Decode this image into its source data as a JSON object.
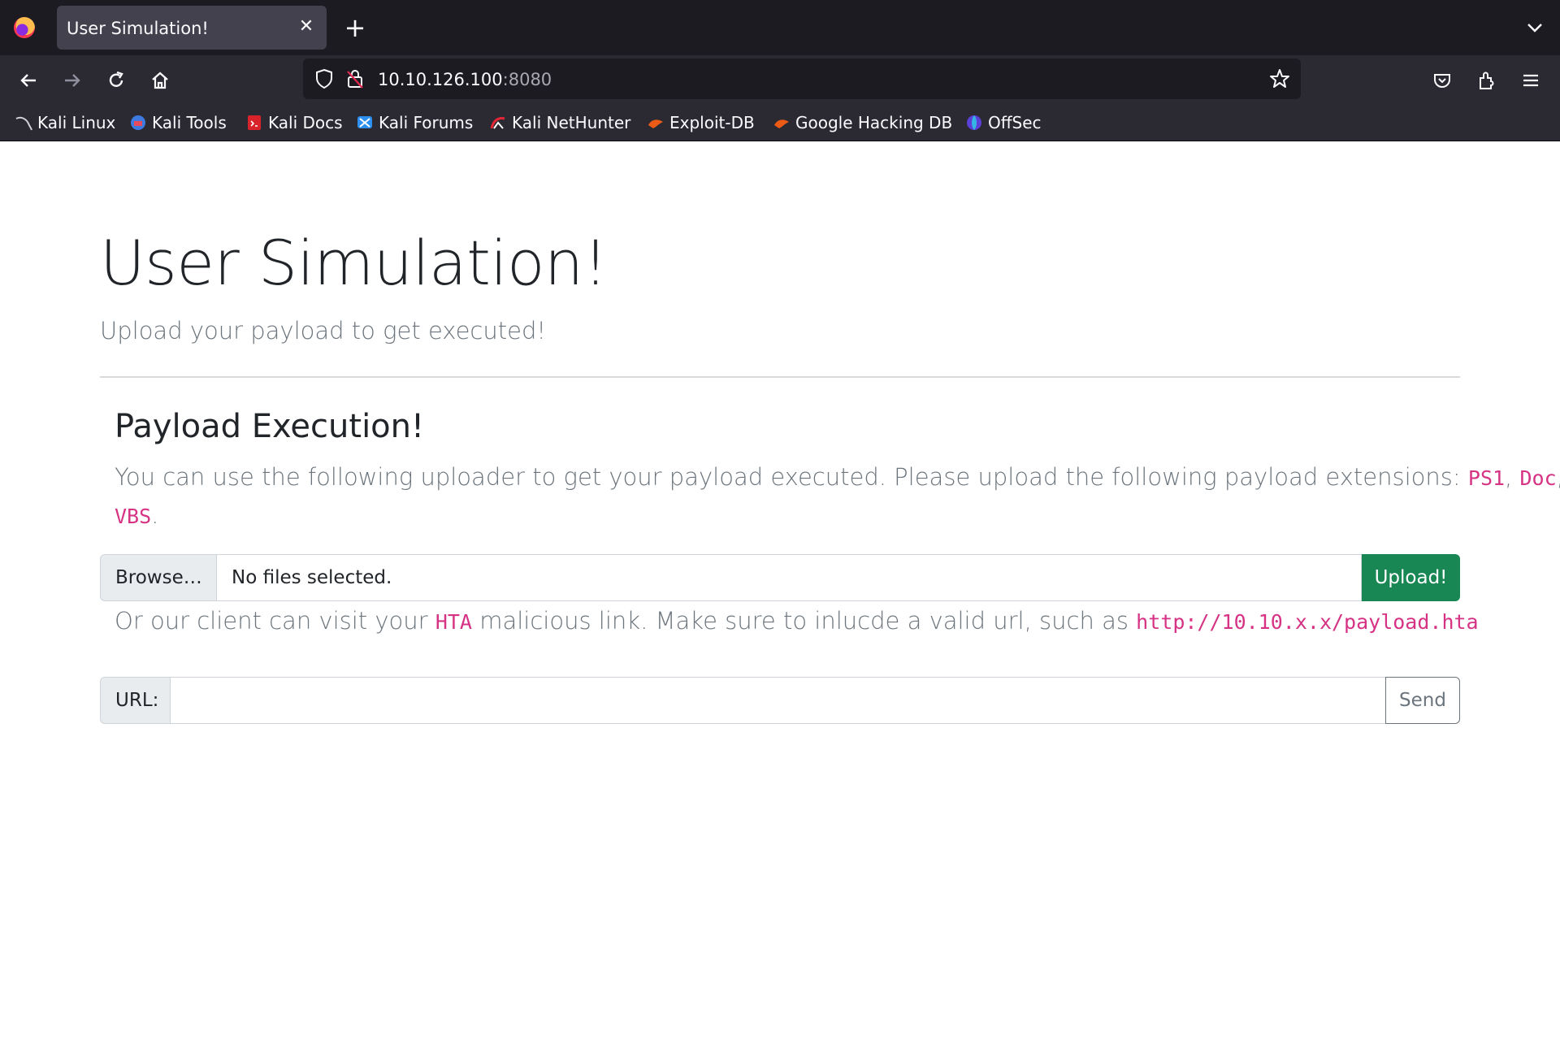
{
  "browser": {
    "tab_title": "User Simulation!",
    "tab_close_icon": "close-icon",
    "new_tab_icon": "plus-icon",
    "url_host": "10.10.126.100",
    "url_port": ":8080",
    "bookmarks": [
      {
        "label": "Kali Linux",
        "icon": "kali-dragon-icon"
      },
      {
        "label": "Kali Tools",
        "icon": "kali-tools-icon"
      },
      {
        "label": "Kali Docs",
        "icon": "kali-docs-icon"
      },
      {
        "label": "Kali Forums",
        "icon": "kali-forums-icon"
      },
      {
        "label": "Kali NetHunter",
        "icon": "nethunter-icon"
      },
      {
        "label": "Exploit-DB",
        "icon": "exploit-db-icon"
      },
      {
        "label": "Google Hacking DB",
        "icon": "ghdb-icon"
      },
      {
        "label": "OffSec",
        "icon": "offsec-icon"
      }
    ]
  },
  "page": {
    "title": "User Simulation!",
    "lead": "Upload your payload to get executed!",
    "section_title": "Payload Execution!",
    "upload_text_1": "You can use the following uploader to get your payload executed. Please upload the following payload extensions: ",
    "ext_ps1": "PS1",
    "sep_1": ", ",
    "ext_doc": "Doc",
    "sep_2": ",",
    "ext_vbs": "VBS",
    "period": ".",
    "browse_label": "Browse…",
    "file_status": "No files selected.",
    "upload_button": "Upload!",
    "link_text_1": "Or our client can visit your ",
    "hta_code": "HTA",
    "link_text_2": " malicious link. Make sure to inlucde a valid url, such as ",
    "example_url": "http://10.10.x.x/payload.hta",
    "url_label": "URL:",
    "url_value": "",
    "send_button": "Send"
  }
}
